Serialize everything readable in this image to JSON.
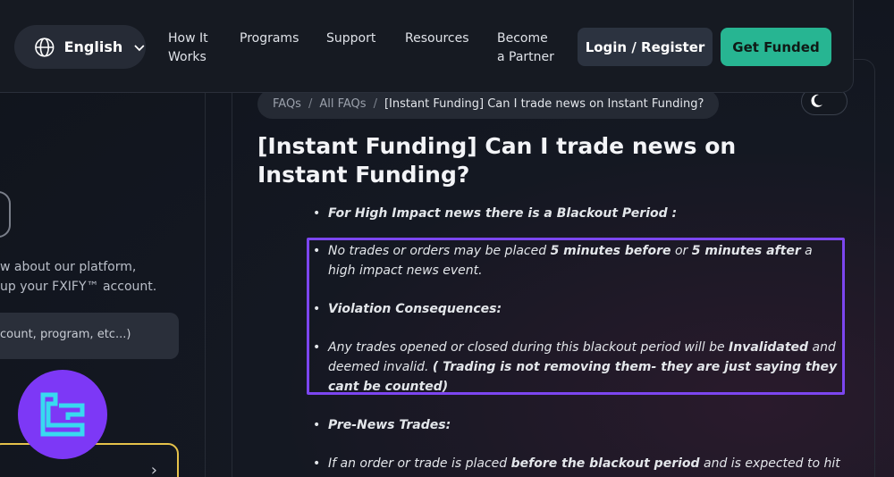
{
  "nav": {
    "language": "English",
    "links": [
      "How It\nWorks",
      "Programs",
      "Support",
      "Resources",
      "Become\na Partner"
    ],
    "login": "Login / Register",
    "get_funded": "Get Funded"
  },
  "sidebar": {
    "description": "w about our platform,\nup your FXIFY™ account.",
    "search_placeholder": "count, program, etc...)",
    "card_arrow": "›"
  },
  "breadcrumb": {
    "faqs": "FAQs",
    "all_faqs": "All FAQs",
    "separator": "/",
    "current": "[Instant Funding] Can I trade news on Instant Funding?"
  },
  "title": "[Instant Funding] Can I trade news on Instant Funding?",
  "article": {
    "b1": "For High Impact news there is a Blackout Period :",
    "b2_pre": "No trades or orders may be placed ",
    "b2_bold1": "5 minutes before",
    "b2_mid": " or ",
    "b2_bold2": "5 minutes after",
    "b2_post": " a high impact news event.",
    "b3": "Violation Consequences:",
    "b4_pre": "Any trades opened or closed during this blackout period will be ",
    "b4_bold1": "Invalidated",
    "b4_mid": " and deemed invalid. ",
    "b4_bold2": "( Trading is not removing them- they are just saying they cant be counted)",
    "b5": "Pre-News Trades:",
    "b6_pre": "If an order or trade is placed ",
    "b6_bold": "before the blackout period",
    "b6_post": " and is expected to hit its take-"
  },
  "colors": {
    "accent_green": "#27b592",
    "highlight_purple": "#7c46f0",
    "logo_purple": "#7d38f6",
    "logo_cyan": "#38d9f0",
    "card_border_yellow": "#e6c24a"
  }
}
